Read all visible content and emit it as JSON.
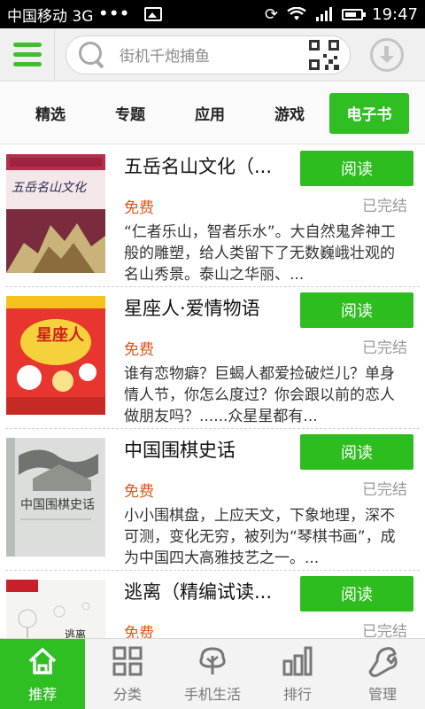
{
  "status_bar": {
    "carrier": "中国移动 3G",
    "dots": "•••",
    "time": "19:47"
  },
  "search": {
    "placeholder": "街机千炮捕鱼"
  },
  "tabs": [
    {
      "label": "精选",
      "active": false
    },
    {
      "label": "专题",
      "active": false
    },
    {
      "label": "应用",
      "active": false
    },
    {
      "label": "游戏",
      "active": false
    },
    {
      "label": "电子书",
      "active": true
    }
  ],
  "books": [
    {
      "title": "五岳名山文化（...",
      "read_label": "阅读",
      "price": "免费",
      "status": "已完结",
      "description": "“仁者乐山，智者乐水”。大自然鬼斧神工般的雕塑，给人类留下了无数巍峨壮观的名山秀景。泰山之华丽、..."
    },
    {
      "title": "星座人·爱情物语",
      "read_label": "阅读",
      "price": "免费",
      "status": "已完结",
      "description": "谁有恋物癖？巨蝎人都爱捡破烂儿？单身情人节，你怎么度过？你会跟以前的恋人做朋友吗？......众星星都有..."
    },
    {
      "title": "中国围棋史话",
      "read_label": "阅读",
      "price": "免费",
      "status": "已完结",
      "description": "小小围棋盘，上应天文，下象地理，深不可测，变化无穷，被列为“琴棋书画”，成为中国四大高雅技艺之一。..."
    },
    {
      "title": "逃离（精编试读...",
      "read_label": "阅读",
      "price": "免费",
      "status": "已完结",
      "description": ""
    }
  ],
  "covers": [
    {
      "text": "五岳名山文化"
    },
    {
      "text": "星座人"
    },
    {
      "text": "中国围棋史话"
    },
    {
      "text": "逃离"
    }
  ],
  "bottom_nav": [
    {
      "label": "推荐",
      "icon": "home-icon",
      "active": true
    },
    {
      "label": "分类",
      "icon": "grid-icon",
      "active": false
    },
    {
      "label": "手机生活",
      "icon": "tree-icon",
      "active": false
    },
    {
      "label": "排行",
      "icon": "bar-chart-icon",
      "active": false
    },
    {
      "label": "管理",
      "icon": "wrench-icon",
      "active": false
    }
  ],
  "colors": {
    "accent_green": "#2fbf23",
    "price_orange": "#e1551c"
  }
}
